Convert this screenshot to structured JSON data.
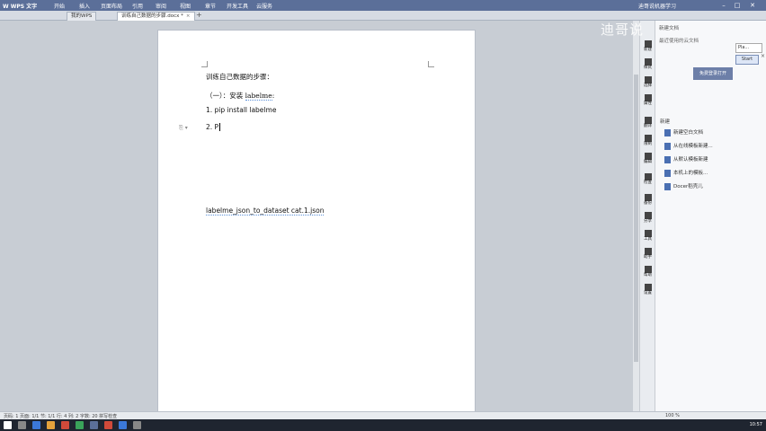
{
  "titlebar": {
    "app_name": "W WPS 文字",
    "menus": [
      "开始",
      "插入",
      "页面布局",
      "引用",
      "审阅",
      "视图",
      "章节",
      "开发工具",
      "云服务"
    ],
    "user": "迪哥说机器学习"
  },
  "tabs": [
    {
      "label": "我的WPS"
    },
    {
      "label": "训练自己数据的步骤.docx *"
    }
  ],
  "document": {
    "heading": "训练自己数据的步骤：",
    "line1_prefix": "（一）：安装 ",
    "line1_word": "labelme",
    "line1_suffix": ":",
    "line2_num": "1.",
    "line2_text": "pip install labelme",
    "line3_num": "2.",
    "line3_text": "P",
    "line4_text": "labelme_json_to_dataset cat.1.json"
  },
  "panel": {
    "header": "新建文档",
    "recent_label": "最近使用的云文档",
    "search_placeholder": "Pla...",
    "start_label": "Start",
    "open_button": "免费登录打开",
    "section_title": "新建",
    "items": [
      {
        "label": "新建空白文档"
      },
      {
        "label": "从在线模板新建..."
      },
      {
        "label": "从默认模板新建"
      },
      {
        "label": "本机上的模板..."
      },
      {
        "label": "Docer稻壳儿"
      }
    ]
  },
  "strip_icons": [
    {
      "label": "新建",
      "icon": "new-icon"
    },
    {
      "label": "样式",
      "icon": "style-icon"
    },
    {
      "label": "选择",
      "icon": "select-icon"
    },
    {
      "label": "属性",
      "icon": "properties-icon"
    },
    {
      "label": "翻译",
      "icon": "translate-icon"
    },
    {
      "label": "限制",
      "icon": "restrict-icon"
    },
    {
      "label": "编辑",
      "icon": "edit-icon"
    },
    {
      "label": "检查",
      "icon": "check-icon"
    },
    {
      "label": "备份",
      "icon": "backup-icon"
    },
    {
      "label": "分享",
      "icon": "share-icon"
    },
    {
      "label": "工具",
      "icon": "tools-icon"
    },
    {
      "label": "助手",
      "icon": "assistant-icon"
    },
    {
      "label": "帮助",
      "icon": "help-icon"
    },
    {
      "label": "设置",
      "icon": "settings-icon"
    }
  ],
  "status": {
    "left": "页码: 1   页面: 1/1   节: 1/1   行: 4   列: 2   字数: 20   拼写检查",
    "zoom": "100 %"
  },
  "watermark": "迪哥说",
  "taskbar": {
    "time": "10:57"
  },
  "colors": {
    "titlebar": "#5b6f99",
    "accent": "#6d7fa8",
    "background": "#c8cdd4"
  }
}
